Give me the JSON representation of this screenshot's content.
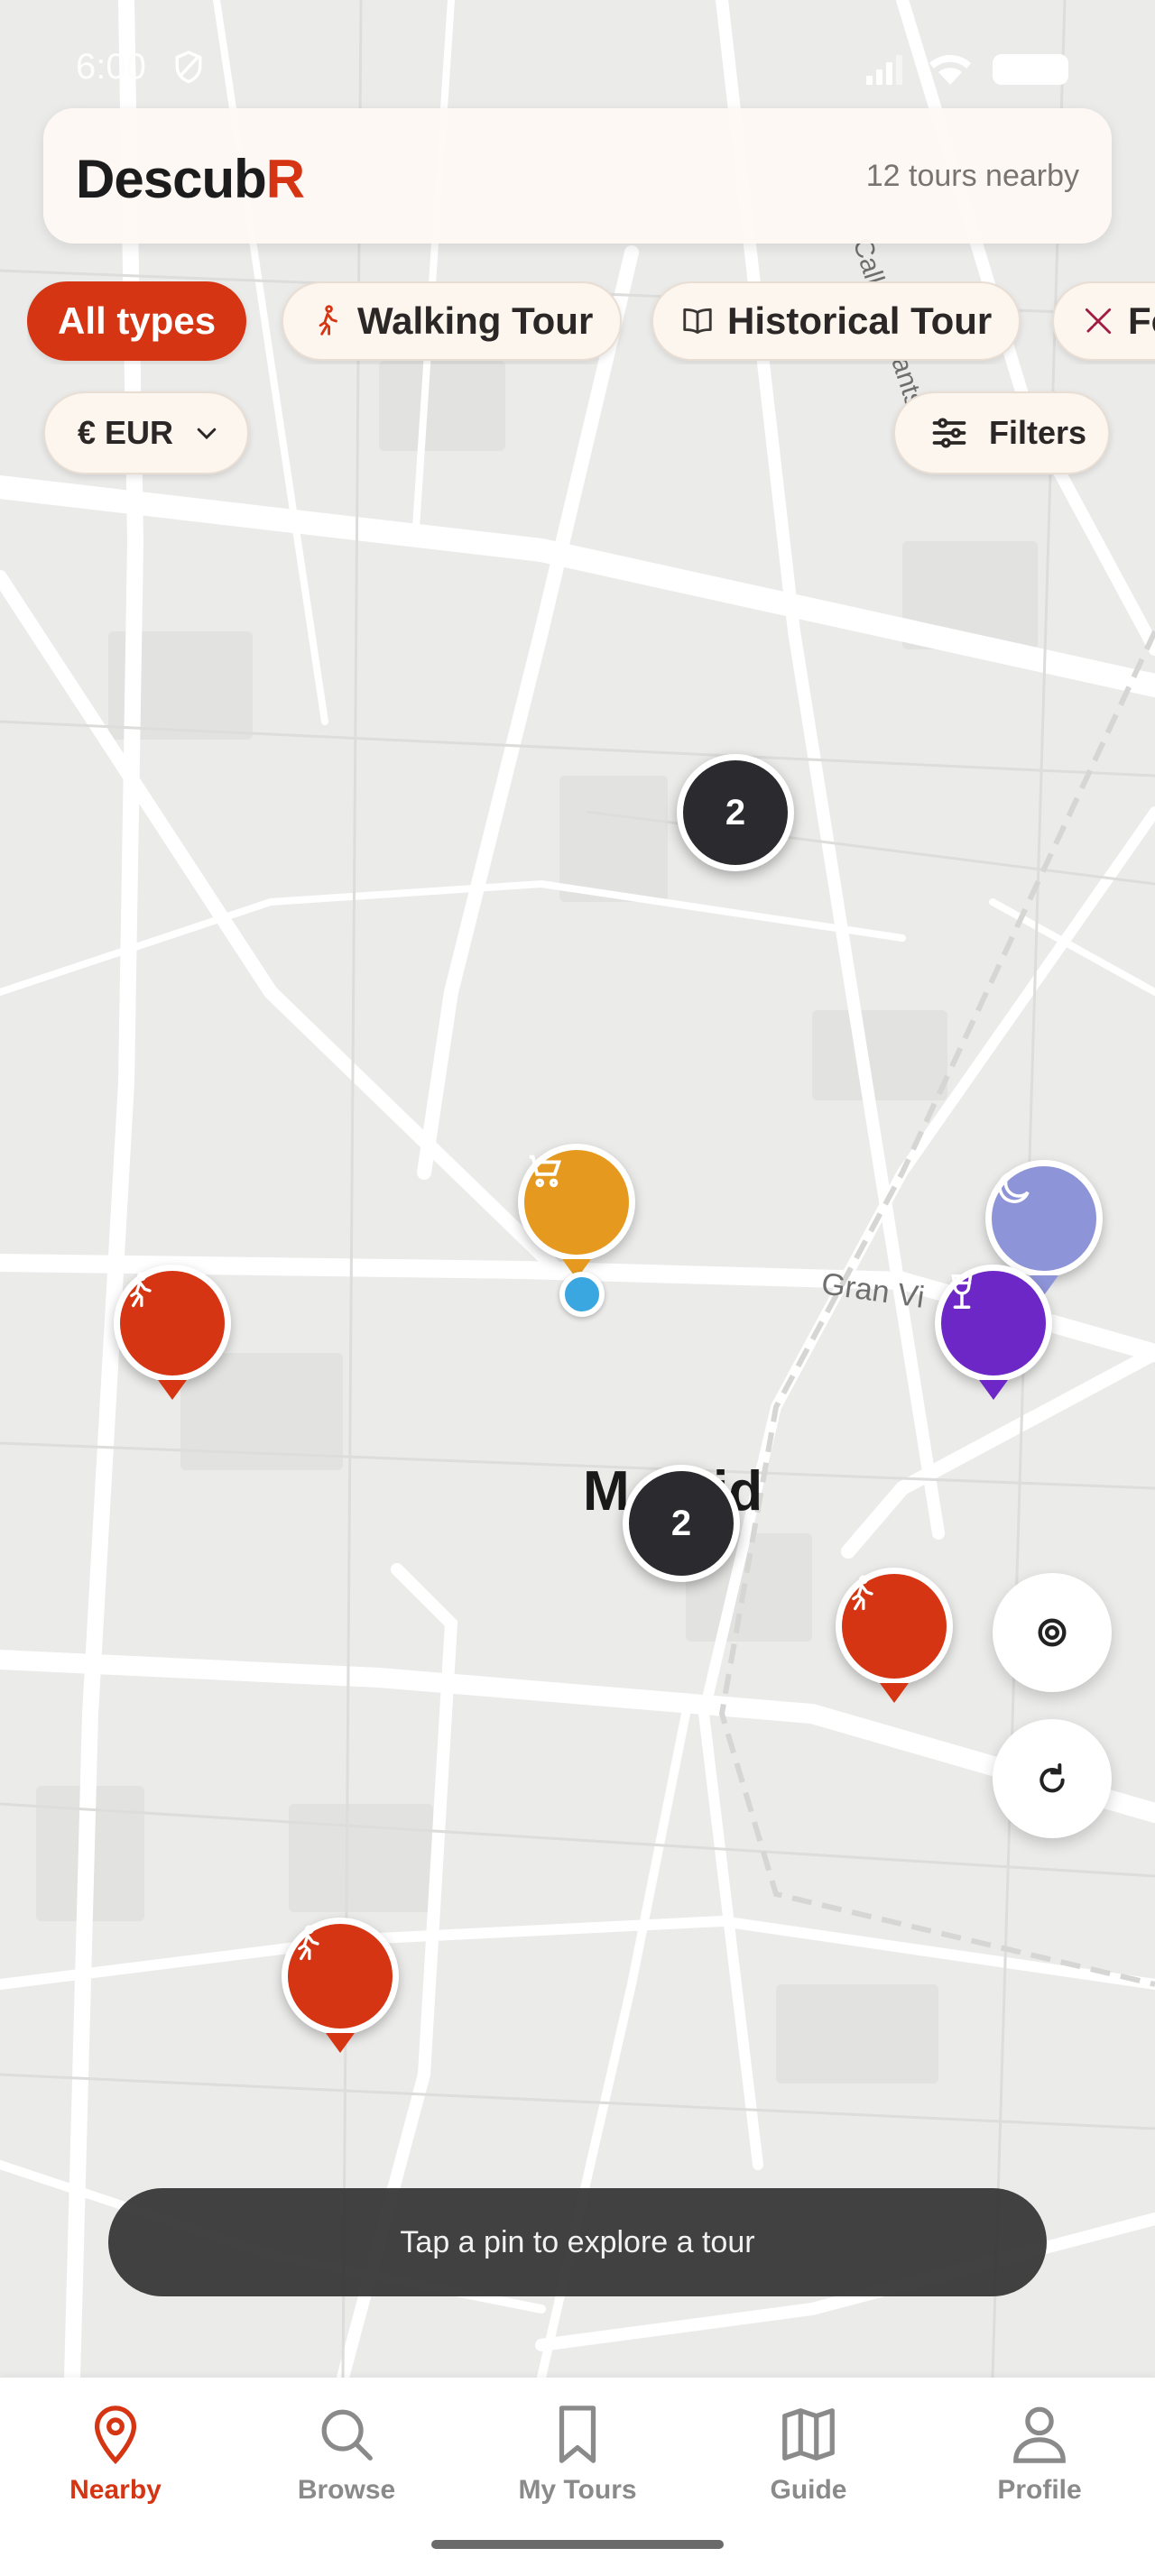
{
  "status_bar": {
    "time": "6:00"
  },
  "header": {
    "brand_main": "Descub",
    "brand_accent": "R",
    "nearby": "12 tours nearby"
  },
  "chips": [
    {
      "label": "All types",
      "active": true
    },
    {
      "label": "Walking Tour",
      "icon": "walking-icon"
    },
    {
      "label": "Historical Tour",
      "icon": "book-icon"
    },
    {
      "label": "Fo",
      "icon": "utensils-icon"
    }
  ],
  "currency": {
    "label": "€ EUR"
  },
  "filters": {
    "label": "Filters"
  },
  "map": {
    "city_label_left": "M",
    "city_label_right": "id",
    "street_label": "Gran Vi",
    "street_label_2": "Calle de Sants-Engr",
    "clusters": [
      "2",
      "2"
    ]
  },
  "pins": [
    {
      "icon": "cart-icon",
      "color": "#e59a1f"
    },
    {
      "icon": "walking-icon",
      "color": "#d63513"
    },
    {
      "icon": "moon-icon",
      "color": "#8e94d8"
    },
    {
      "icon": "wine-glass-icon",
      "color": "#6e27c7"
    },
    {
      "icon": "walking-icon",
      "color": "#d63513"
    },
    {
      "icon": "walking-icon",
      "color": "#d63513"
    }
  ],
  "toast": {
    "text": "Tap a pin to explore a tour"
  },
  "nav": {
    "items": [
      {
        "label": "Nearby",
        "icon": "location-pin-icon",
        "active": true
      },
      {
        "label": "Browse",
        "icon": "search-icon"
      },
      {
        "label": "My Tours",
        "icon": "bookmark-icon"
      },
      {
        "label": "Guide",
        "icon": "map-icon"
      },
      {
        "label": "Profile",
        "icon": "person-icon"
      }
    ]
  },
  "colors": {
    "accent": "#d63513",
    "cluster": "#2b2a2e"
  }
}
